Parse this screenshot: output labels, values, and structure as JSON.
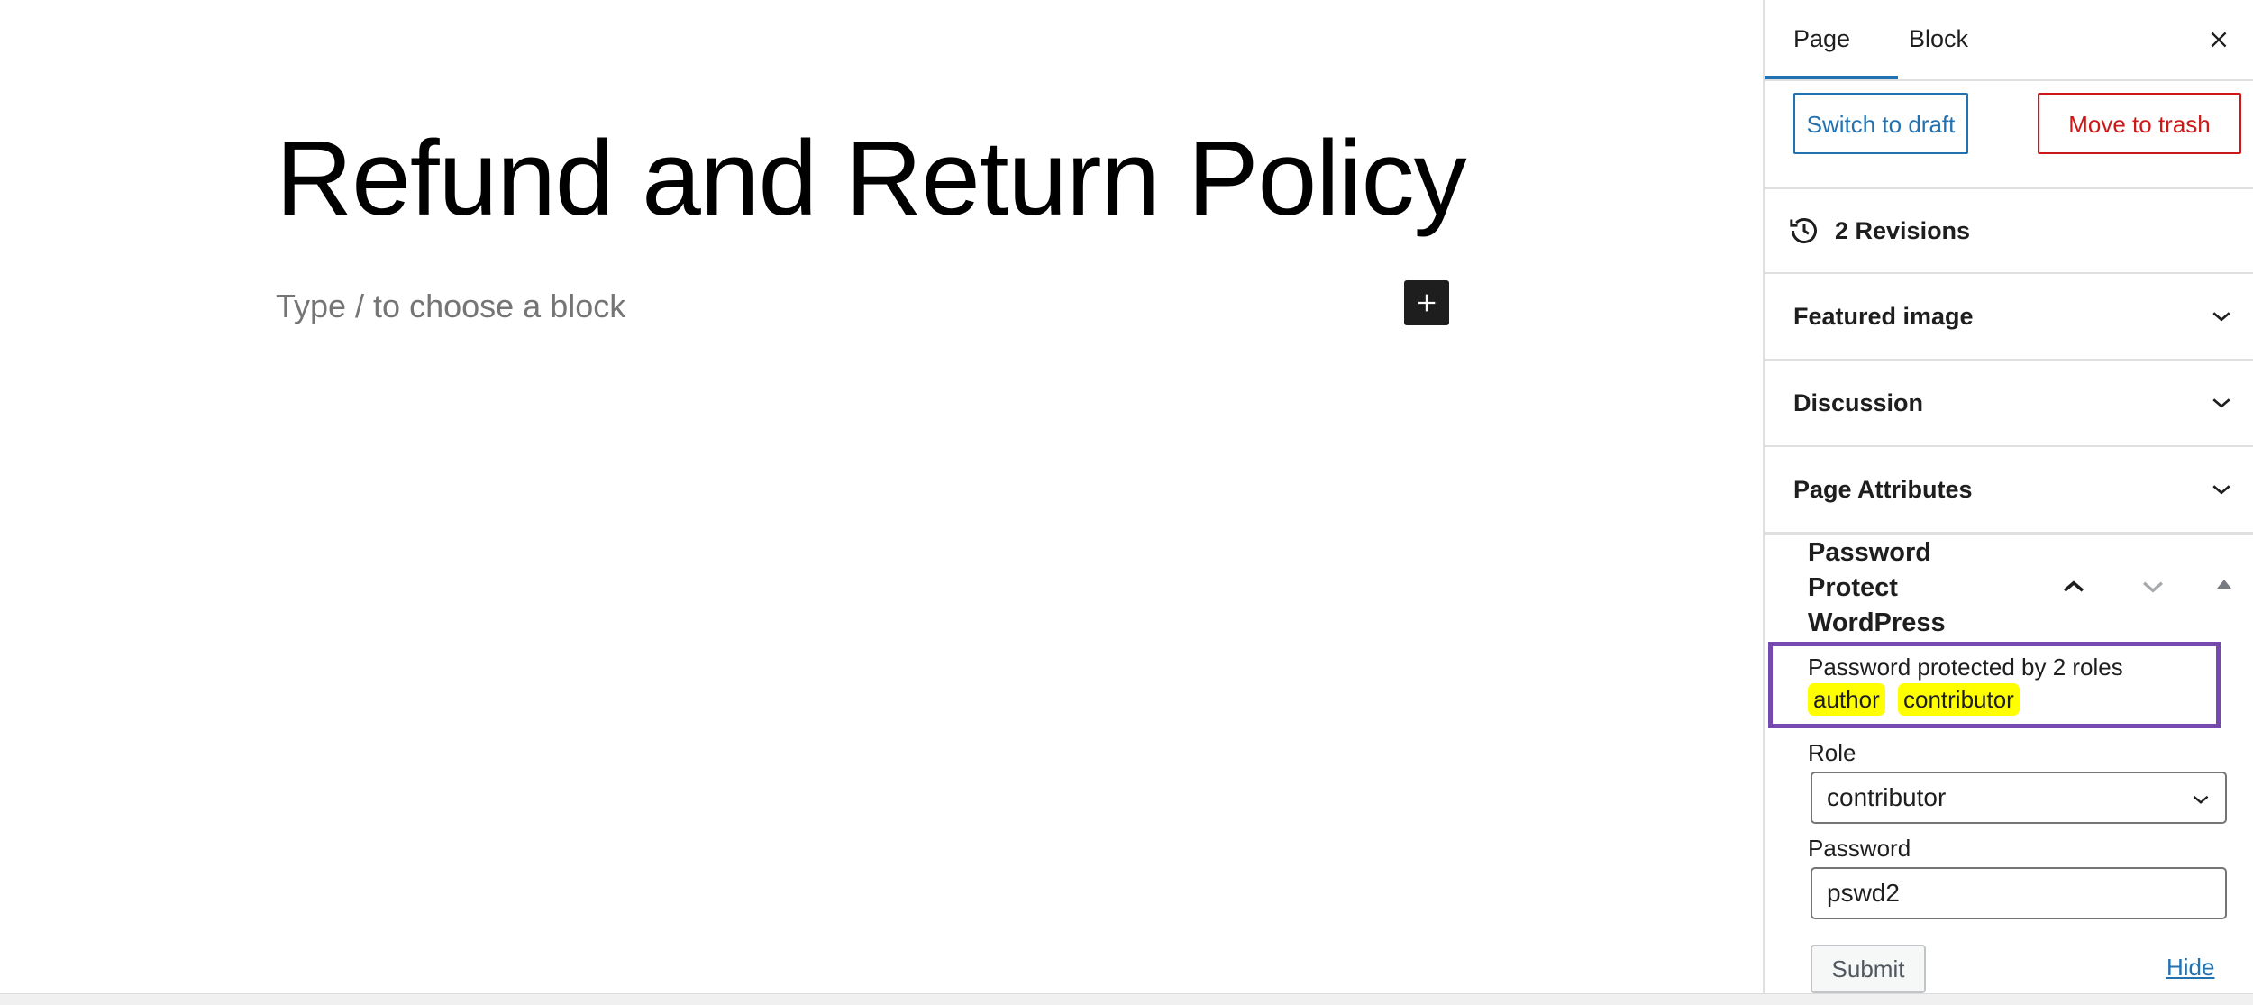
{
  "editor": {
    "title": "Refund and Return Policy",
    "block_placeholder": "Type / to choose a block",
    "inserter_icon": "plus-icon"
  },
  "sidebar": {
    "tabs": [
      {
        "label": "Page",
        "active": true
      },
      {
        "label": "Block",
        "active": false
      }
    ],
    "close_icon": "close-icon",
    "switch_to_draft_label": "Switch to draft",
    "move_to_trash_label": "Move to trash",
    "revisions_label": "2 Revisions",
    "revisions_icon": "history-icon",
    "panels": [
      {
        "label": "Featured image"
      },
      {
        "label": "Discussion"
      },
      {
        "label": "Page Attributes"
      }
    ],
    "ppw": {
      "title": "Password Protect WordPress",
      "protected_text": "Password protected by 2 roles",
      "roles": [
        "author",
        "contributor"
      ],
      "role_label": "Role",
      "role_value": "contributor",
      "password_label": "Password",
      "password_value": "pswd2",
      "submit_label": "Submit",
      "hide_label": "Hide"
    }
  },
  "colors": {
    "accent": "#2271b1",
    "danger": "#cc1818",
    "highlight_box": "#7649b0",
    "chip": "#ffff00"
  }
}
